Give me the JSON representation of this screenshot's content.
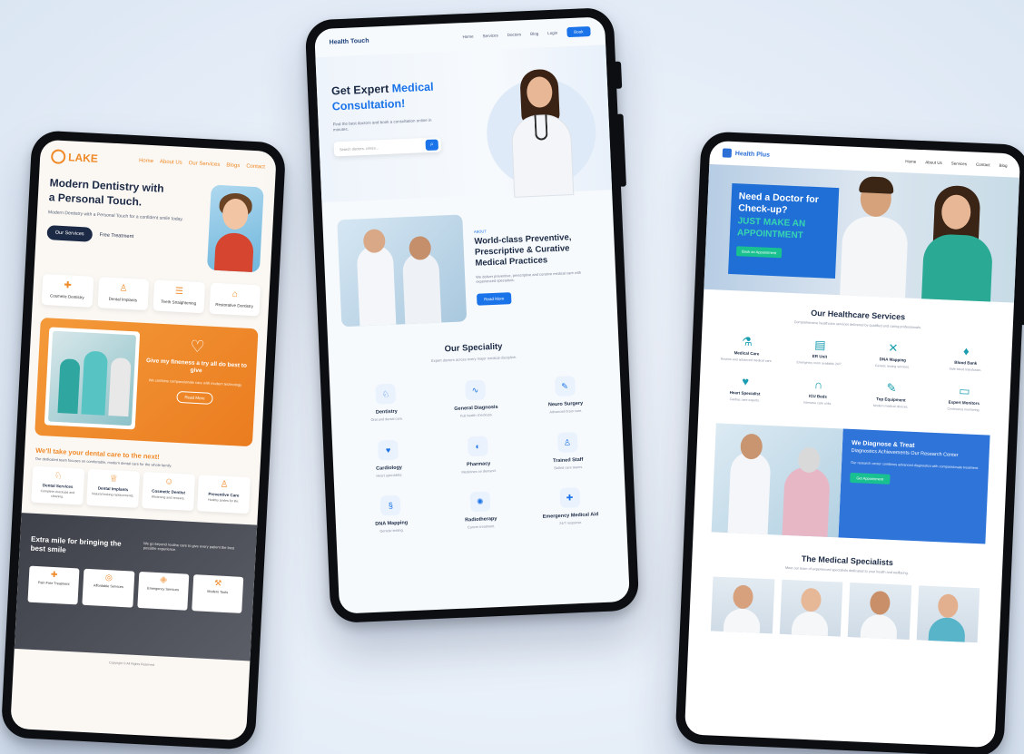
{
  "device1": {
    "logo": "LAKE",
    "nav": [
      "Home",
      "About Us",
      "Our Services",
      "Blogs",
      "Contact"
    ],
    "hero": {
      "title": "Modern Dentistry with a Personal Touch.",
      "subtitle": "Modern Dentistry with a Personal Touch for a confident smile today.",
      "primary_button": "Our Services",
      "secondary_button": "Free Treatment"
    },
    "cards": [
      {
        "icon": "tooth-icon",
        "label": "Cosmetic Dentistry"
      },
      {
        "icon": "implant-icon",
        "label": "Dental Implants"
      },
      {
        "icon": "braces-icon",
        "label": "Teeth Straightening"
      },
      {
        "icon": "clinic-icon",
        "label": "Restorative Dentistry"
      }
    ],
    "promo": {
      "title": "Give my fineness a try all do best to give",
      "text": "We combine compassionate care with modern technology.",
      "button": "Read More"
    },
    "section_title": "We'll take your dental care to the next!",
    "section_text": "Our dedicated team focuses on comfortable, modern dental care for the whole family.",
    "features": [
      {
        "title": "Dental Services",
        "text": "Complete checkups and cleaning."
      },
      {
        "title": "Dental Implants",
        "text": "Natural looking replacements."
      },
      {
        "title": "Cosmetic Dentist",
        "text": "Whitening and veneers."
      },
      {
        "title": "Preventive Care",
        "text": "Healthy smiles for life."
      }
    ],
    "dark_title": "Extra mile for bringing the best smile",
    "dark_text": "We go beyond routine care to give every patient the best possible experience.",
    "dark_cards": [
      "Pain Free Treatment",
      "Affordable Services",
      "Emergency Services",
      "Modern Tools"
    ],
    "footer": "Copyright © All Rights Reserved"
  },
  "device2": {
    "logo": "Health Touch",
    "nav": [
      "Home",
      "Services",
      "Doctors",
      "Blog",
      "Login"
    ],
    "nav_button": "Book",
    "hero": {
      "title_plain": "Get Expert",
      "title_accent": "Medical Consultation!",
      "subtitle": "Find the best doctors and book a consultation online in minutes.",
      "search_placeholder": "Search doctors, clinics..."
    },
    "about": {
      "tag": "ABOUT",
      "title": "World-class Preventive, Prescriptive & Curative Medical Practices",
      "text": "We deliver preventive, prescriptive and curative medical care with experienced specialists.",
      "button": "Read More"
    },
    "speciality_title": "Our Speciality",
    "speciality_text": "Expert doctors across every major medical discipline.",
    "specialities": [
      {
        "icon": "tooth-icon",
        "title": "Dentistry",
        "text": "Oral and dental care."
      },
      {
        "icon": "stethoscope-icon",
        "title": "General Diagnosis",
        "text": "Full health checkups."
      },
      {
        "icon": "scalpel-icon",
        "title": "Neuro Surgery",
        "text": "Advanced brain care."
      },
      {
        "icon": "heart-icon",
        "title": "Cardiology",
        "text": "Heart specialists."
      },
      {
        "icon": "pill-icon",
        "title": "Pharmacy",
        "text": "Medicines on demand."
      },
      {
        "icon": "nurse-icon",
        "title": "Trained Staff",
        "text": "Skilled care teams."
      },
      {
        "icon": "dna-icon",
        "title": "DNA Mapping",
        "text": "Genetic testing."
      },
      {
        "icon": "radiation-icon",
        "title": "Radiotherapy",
        "text": "Cancer treatment."
      },
      {
        "icon": "ambulance-icon",
        "title": "Emergency Medical Aid",
        "text": "24/7 response."
      }
    ]
  },
  "device3": {
    "logo": "Health Plus",
    "nav": [
      "Home",
      "About Us",
      "Services",
      "Contact",
      "Blog"
    ],
    "hero": {
      "title": "Need a Doctor for Check-up?",
      "subtitle": "JUST MAKE AN APPOINTMENT",
      "button": "Book an Appointment"
    },
    "services_title": "Our Healthcare Services",
    "services_text": "Comprehensive healthcare services delivered by qualified and caring professionals.",
    "services": [
      {
        "icon": "flask-icon",
        "title": "Medical Care",
        "text": "Routine and advanced medical care."
      },
      {
        "icon": "bed-icon",
        "title": "ER Unit",
        "text": "Emergency room available 24/7."
      },
      {
        "icon": "dna-icon",
        "title": "DNA Mapping",
        "text": "Genetic testing services."
      },
      {
        "icon": "drop-icon",
        "title": "Blood Bank",
        "text": "Safe blood transfusion."
      },
      {
        "icon": "heart-icon",
        "title": "Heart Specialist",
        "text": "Cardiac care experts."
      },
      {
        "icon": "stethoscope-icon",
        "title": "ICU Beds",
        "text": "Intensive care units."
      },
      {
        "icon": "syringe-icon",
        "title": "Top Equipment",
        "text": "Modern medical devices."
      },
      {
        "icon": "monitor-icon",
        "title": "Expert Monitors",
        "text": "Continuous monitoring."
      }
    ],
    "diagnose": {
      "title": "We Diagnose & Treat",
      "subtitle": "Diagnostics Achievements Our Research Center",
      "text": "Our research center combines advanced diagnostics with compassionate treatment.",
      "button": "Get Appointment"
    },
    "specialists_title": "The Medical Specialists",
    "specialists_text": "Meet our team of experienced specialists dedicated to your health and wellbeing."
  }
}
